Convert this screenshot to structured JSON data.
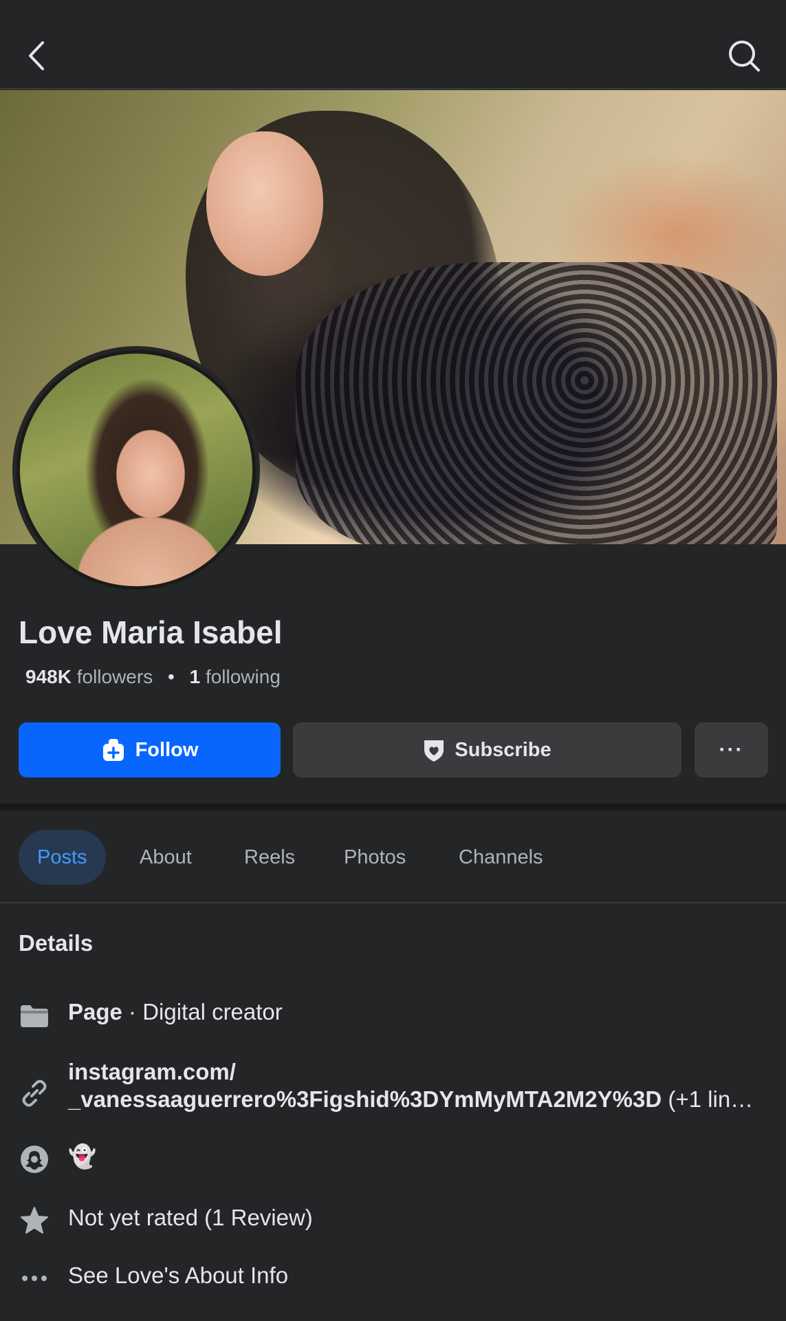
{
  "profile": {
    "name": "Love Maria Isabel",
    "followers_count": "948K",
    "followers_label": "followers",
    "following_count": "1",
    "following_label": "following"
  },
  "actions": {
    "follow_label": "Follow",
    "subscribe_label": "Subscribe",
    "more_label": "···"
  },
  "tabs": [
    {
      "label": "Posts",
      "active": true
    },
    {
      "label": "About"
    },
    {
      "label": "Reels"
    },
    {
      "label": "Photos"
    },
    {
      "label": "Channels"
    }
  ],
  "details": {
    "title": "Details",
    "page_type_bold": "Page",
    "page_type_rest": " · Digital creator",
    "link_line1": "instagram.com/",
    "link_line2": "_vanessaaguerrero%3Figshid%3DYmMyMTA2M2Y%3D",
    "link_suffix": " (+1 lin…",
    "snapchat_emoji": "👻",
    "rating": "Not yet rated (1 Review)",
    "about_info": "See Love's About Info"
  },
  "colors": {
    "background": "#242526",
    "follow_button": "#0866ff",
    "secondary_button": "#3a3b3c",
    "link_blue": "#4599ff",
    "active_tab_bg": "#263951"
  },
  "icons": {
    "back": "chevron-left-icon",
    "search": "search-icon",
    "follow": "user-add-icon",
    "subscribe": "heart-shield-icon",
    "page": "page-flag-icon",
    "link": "link-icon",
    "snapchat": "snapchat-icon",
    "rating": "star-icon",
    "more": "more-dots-icon"
  }
}
